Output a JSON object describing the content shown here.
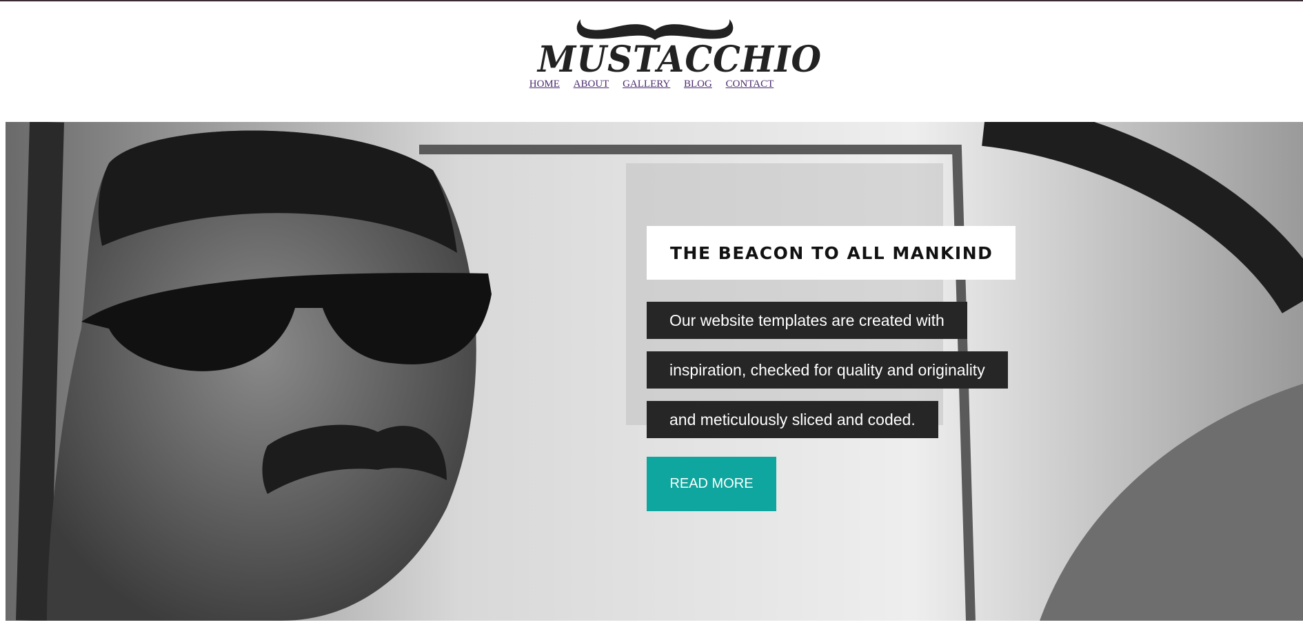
{
  "site": {
    "logo_text": "MUSTACCHIO"
  },
  "nav": {
    "items": [
      "HOME",
      "ABOUT",
      "GALLERY",
      "BLOG",
      "CONTACT"
    ]
  },
  "hero": {
    "headline": "THE BEACON TO ALL MANKIND",
    "lines": [
      "Our website templates are created with",
      "inspiration, checked for quality and originality",
      "and meticulously sliced and coded."
    ],
    "cta_label": "READ MORE",
    "cta_color": "#0ea69e",
    "text_box_color": "#262626"
  }
}
